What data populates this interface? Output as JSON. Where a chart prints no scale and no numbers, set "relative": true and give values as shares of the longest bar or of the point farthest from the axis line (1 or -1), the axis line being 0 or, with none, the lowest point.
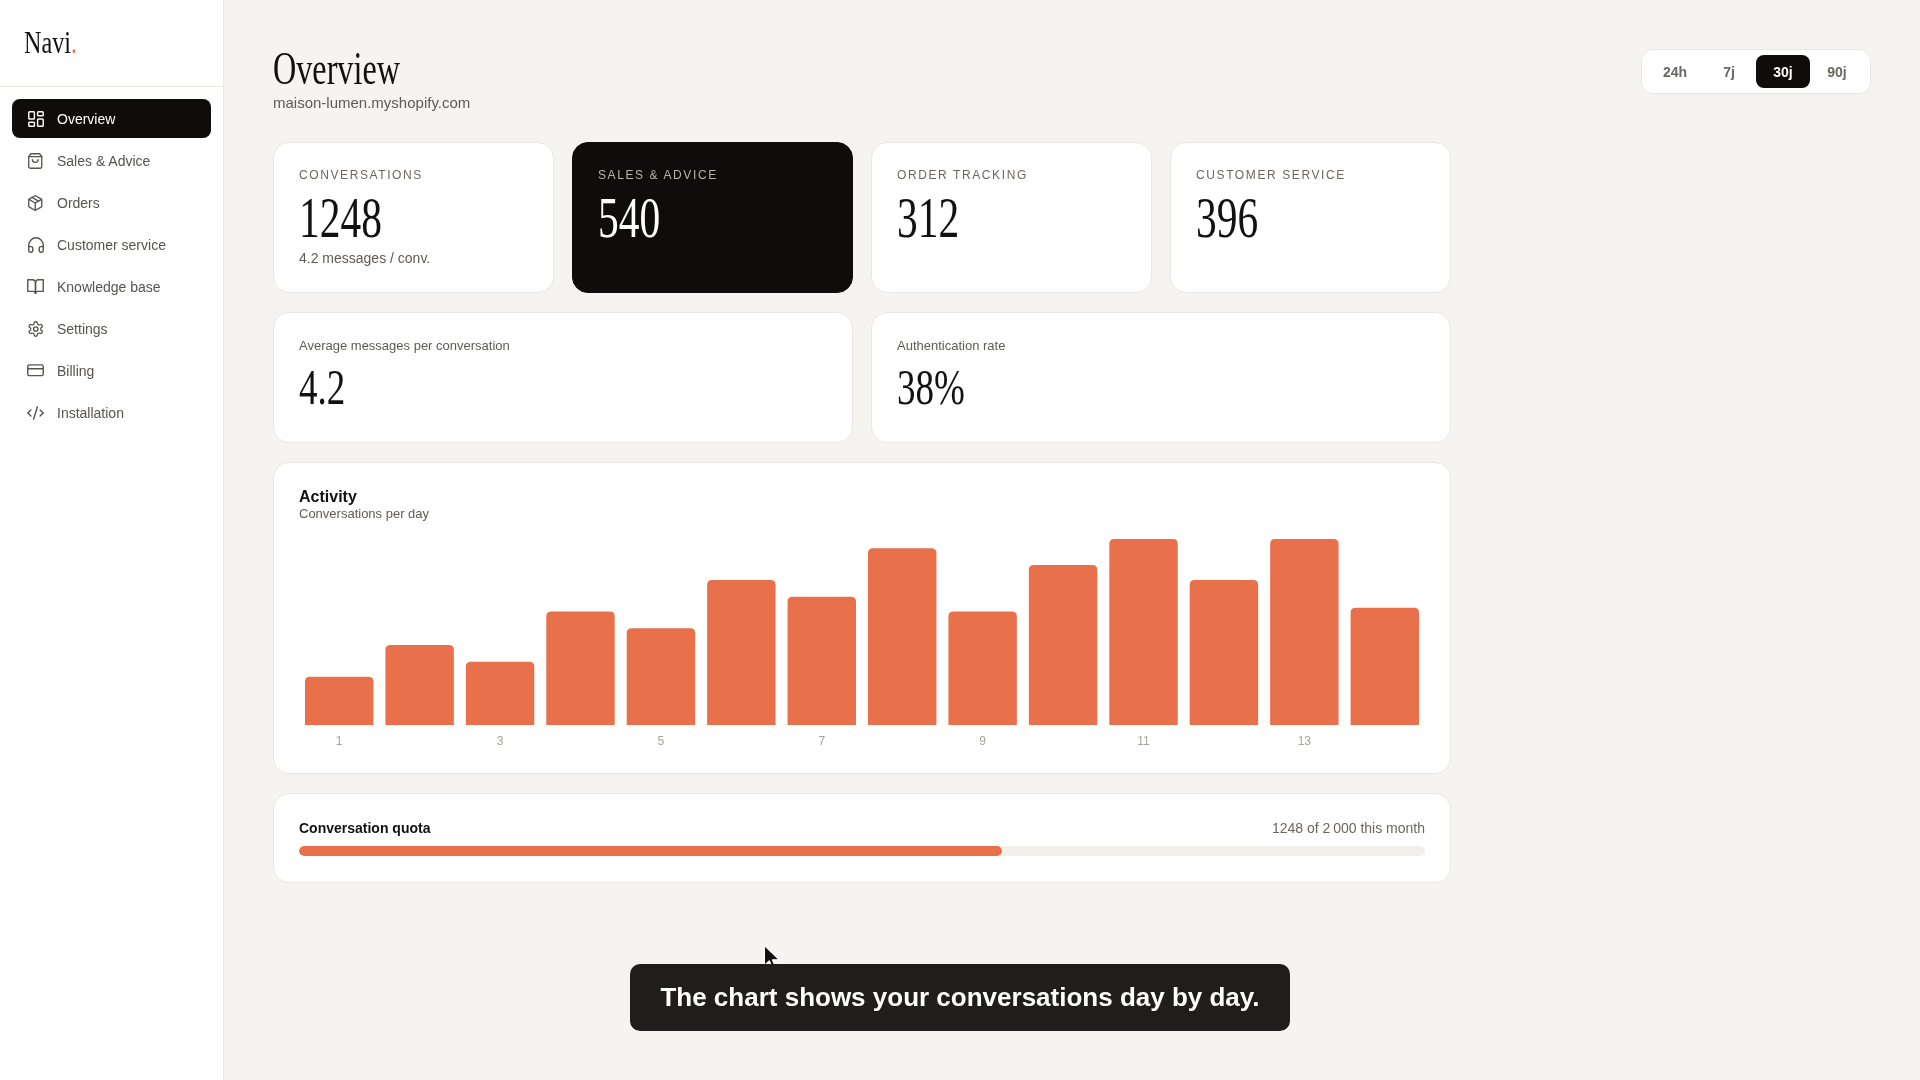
{
  "sidebar": {
    "logo": {
      "name": "Navi",
      "mark": "."
    },
    "items": [
      {
        "label": "Overview",
        "selected": true
      },
      {
        "label": "Sales & Advice",
        "selected": false
      },
      {
        "label": "Orders",
        "selected": false
      },
      {
        "label": "Customer service",
        "selected": false
      },
      {
        "label": "Knowledge base",
        "selected": false
      },
      {
        "label": "Settings",
        "selected": false
      },
      {
        "label": "Billing",
        "selected": false
      },
      {
        "label": "Installation",
        "selected": false
      }
    ]
  },
  "header": {
    "title": "Overview",
    "subtitle": "maison-lumen.myshopify.com",
    "periods": [
      {
        "label": "24h",
        "selected": false
      },
      {
        "label": "7j",
        "selected": false
      },
      {
        "label": "30j",
        "selected": true
      },
      {
        "label": "90j",
        "selected": false
      }
    ]
  },
  "stat_cards": [
    {
      "label": "CONVERSATIONS",
      "value": "1248",
      "note": "4.2 messages / conv.",
      "selected": false
    },
    {
      "label": "SALES & ADVICE",
      "value": "540",
      "selected": true
    },
    {
      "label": "ORDER TRACKING",
      "value": "312",
      "selected": false
    },
    {
      "label": "CUSTOMER SERVICE",
      "value": "396",
      "selected": false
    }
  ],
  "metrics": [
    {
      "label": "Average messages per conversation",
      "value": "4.2"
    },
    {
      "label": "Authentication rate",
      "value": "38%"
    }
  ],
  "activity": {
    "title": "Activity",
    "subtitle": "Conversations per day",
    "chart_data": {
      "type": "bar",
      "relative": true,
      "x": [
        1,
        2,
        3,
        4,
        5,
        6,
        7,
        8,
        9,
        10,
        11,
        12,
        13,
        14
      ],
      "values": [
        0.26,
        0.43,
        0.34,
        0.61,
        0.52,
        0.78,
        0.69,
        0.95,
        0.61,
        0.86,
        1,
        0.78,
        1,
        0.63
      ],
      "xlim": [
        0.5,
        14.5
      ],
      "xticks": [
        1,
        3,
        5,
        7,
        9,
        11,
        13
      ]
    }
  },
  "quota": {
    "title": "Conversation quota",
    "reading": "1248 of 2 000 this month",
    "level": 0.624
  },
  "caption": {
    "text": "The chart shows your conversations day by day."
  }
}
